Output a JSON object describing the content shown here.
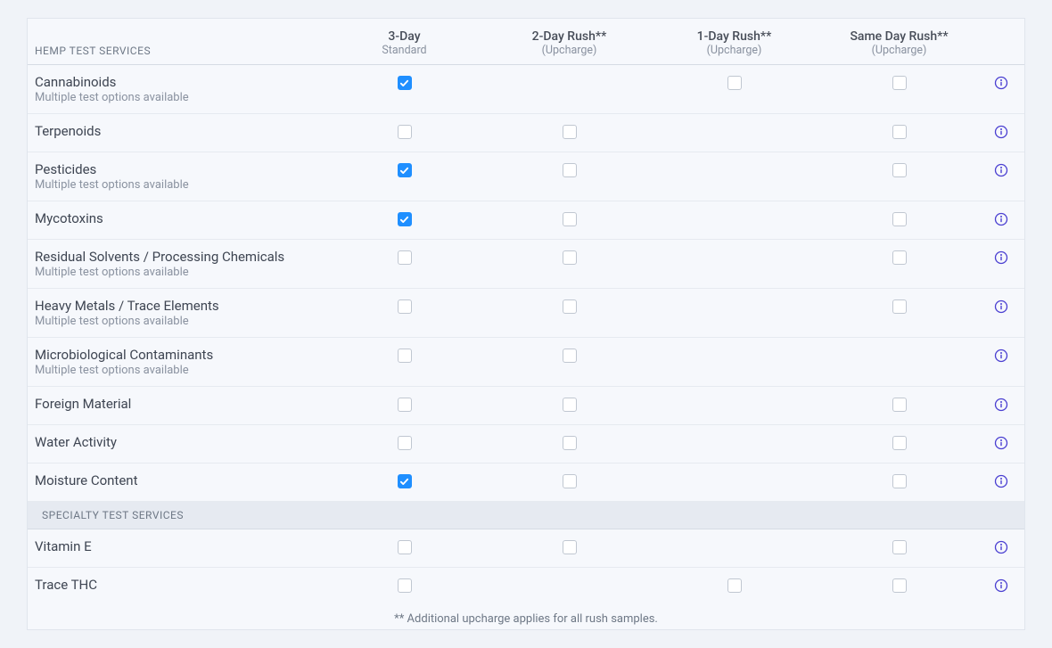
{
  "columns": [
    {
      "title": "3-Day",
      "sub": "Standard"
    },
    {
      "title": "2-Day Rush**",
      "sub": "(Upcharge)"
    },
    {
      "title": "1-Day Rush**",
      "sub": "(Upcharge)"
    },
    {
      "title": "Same Day Rush**",
      "sub": "(Upcharge)"
    }
  ],
  "sections": [
    {
      "label": "HEMP TEST SERVICES",
      "rows": [
        {
          "name": "Cannabinoids",
          "sub": "Multiple test options available",
          "cells": [
            "checked",
            "hidden",
            "unchecked",
            "unchecked"
          ]
        },
        {
          "name": "Terpenoids",
          "sub": "",
          "cells": [
            "unchecked",
            "unchecked",
            "hidden",
            "unchecked"
          ]
        },
        {
          "name": "Pesticides",
          "sub": "Multiple test options available",
          "cells": [
            "checked",
            "unchecked",
            "hidden",
            "unchecked"
          ]
        },
        {
          "name": "Mycotoxins",
          "sub": "",
          "cells": [
            "checked",
            "unchecked",
            "hidden",
            "unchecked"
          ]
        },
        {
          "name": "Residual Solvents / Processing Chemicals",
          "sub": "Multiple test options available",
          "cells": [
            "unchecked",
            "unchecked",
            "hidden",
            "unchecked"
          ]
        },
        {
          "name": "Heavy Metals / Trace Elements",
          "sub": "Multiple test options available",
          "cells": [
            "unchecked",
            "unchecked",
            "hidden",
            "unchecked"
          ]
        },
        {
          "name": "Microbiological Contaminants",
          "sub": "Multiple test options available",
          "cells": [
            "unchecked",
            "unchecked",
            "hidden",
            "hidden"
          ]
        },
        {
          "name": "Foreign Material",
          "sub": "",
          "cells": [
            "unchecked",
            "unchecked",
            "hidden",
            "unchecked"
          ]
        },
        {
          "name": "Water Activity",
          "sub": "",
          "cells": [
            "unchecked",
            "unchecked",
            "hidden",
            "unchecked"
          ]
        },
        {
          "name": "Moisture Content",
          "sub": "",
          "cells": [
            "checked",
            "unchecked",
            "hidden",
            "unchecked"
          ]
        }
      ]
    },
    {
      "label": "SPECIALTY TEST SERVICES",
      "rows": [
        {
          "name": "Vitamin E",
          "sub": "",
          "cells": [
            "unchecked",
            "unchecked",
            "hidden",
            "unchecked"
          ]
        },
        {
          "name": "Trace THC",
          "sub": "",
          "cells": [
            "unchecked",
            "hidden",
            "unchecked",
            "unchecked"
          ]
        }
      ]
    }
  ],
  "footnote": "** Additional upcharge applies for all rush samples."
}
